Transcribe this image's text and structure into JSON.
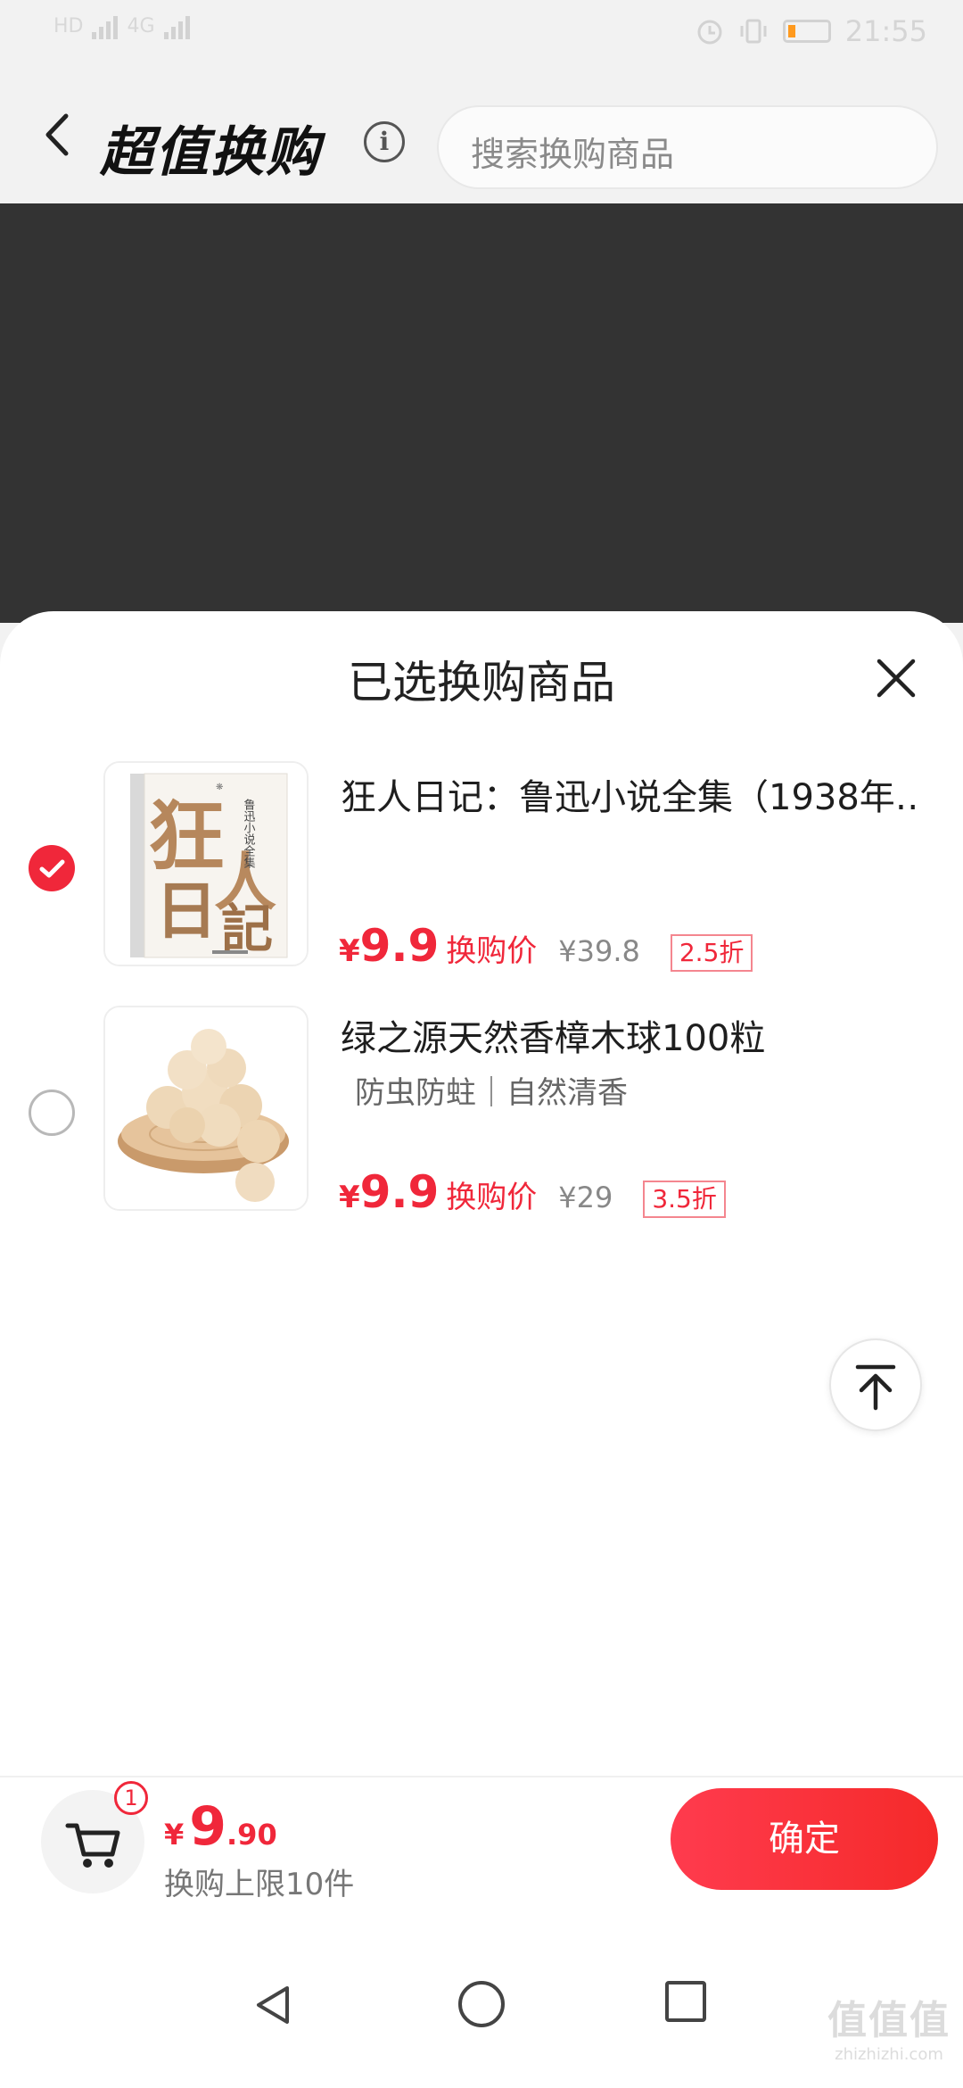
{
  "status_bar": {
    "time": "21:55",
    "network_left": "HD",
    "network_right": "4G"
  },
  "header": {
    "title": "超值换购",
    "info_icon": "info-icon",
    "search_placeholder": "搜索换购商品"
  },
  "sheet": {
    "title": "已选换购商品",
    "items": [
      {
        "name": "狂人日记：鲁迅小说全集（1938年…",
        "subtitle": "",
        "checked": true,
        "currency": "¥",
        "price": "9.9",
        "price_label": "换购价",
        "original_price": "¥39.8",
        "discount": "2.5折",
        "thumb": {
          "cover_big": "狂",
          "cover_big2": "日",
          "cover_big3": "人",
          "cover_big4": "記",
          "cover_side": "鲁迅小说全集"
        }
      },
      {
        "name": "绿之源天然香樟木球100粒",
        "subtitle": "防虫防蛀｜自然清香",
        "checked": false,
        "currency": "¥",
        "price": "9.9",
        "price_label": "换购价",
        "original_price": "¥29",
        "discount": "3.5折"
      }
    ]
  },
  "footer": {
    "cart_badge": "1",
    "currency": "¥",
    "total_int": "9",
    "total_dec": ".90",
    "limit_text": "换购上限10件",
    "confirm_label": "确定"
  },
  "watermark": {
    "big": "值值值",
    "small": "zhizhizhi.com"
  },
  "colors": {
    "accent": "#f0273a",
    "overlay": "#333333",
    "background": "#f2f2f2"
  }
}
